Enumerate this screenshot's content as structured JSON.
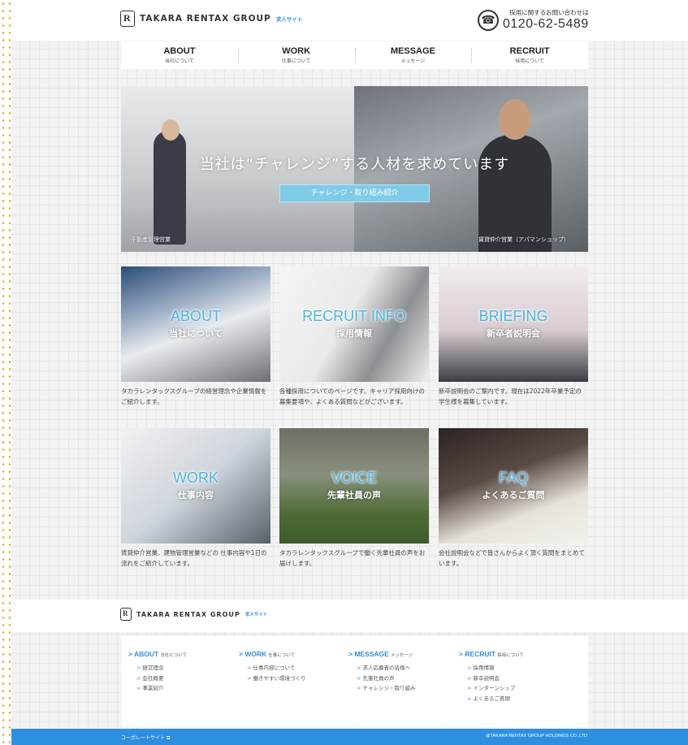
{
  "header": {
    "logo_text": "TAKARA RENTAX GROUP",
    "logo_sub": "求人サイト",
    "tel_caption": "採用に関するお問い合わせは",
    "tel_number": "0120-62-5489"
  },
  "nav": [
    {
      "en": "ABOUT",
      "ja": "当社について"
    },
    {
      "en": "WORK",
      "ja": "仕事について"
    },
    {
      "en": "MESSAGE",
      "ja": "メッセージ"
    },
    {
      "en": "RECRUIT",
      "ja": "採用について"
    }
  ],
  "hero": {
    "headline": "当社は“チャレンジ”する人材を求めています",
    "button": "チャレンジ・取り組み紹介",
    "caption_left": "不動産管理営業",
    "caption_right": "賃貸仲介営業（アパマンショップ）"
  },
  "cards": [
    {
      "en": "ABOUT",
      "ja": "当社について",
      "desc": "タカラレンタックスグループの経営理念や企業情報をご紹介します。"
    },
    {
      "en": "RECRUIT INFO",
      "ja": "採用情報",
      "desc": "各種採用についてのページです。キャリア採用向けの募集要項や、よくある質問などがございます。"
    },
    {
      "en": "BRIEFING",
      "ja": "新卒者説明会",
      "desc": "新卒説明会のご案内です。現在は2022年卒業予定の学生様を募集しています。"
    },
    {
      "en": "WORK",
      "ja": "仕事内容",
      "desc": "賃貸仲介営業、建物管理営業などの 仕事内容や1日の流れをご紹介しています。"
    },
    {
      "en": "VOICE",
      "ja": "先輩社員の声",
      "desc": "タカラレンタックスグループで働く先輩社員の声をお届けします。"
    },
    {
      "en": "FAQ",
      "ja": "よくあるご質問",
      "desc": "会社説明会などで皆さんからよく頂く質問をまとめています。"
    }
  ],
  "footer": {
    "logo_text": "TAKARA RENTAX GROUP",
    "logo_sub": "求人サイト",
    "columns": [
      {
        "head": "ABOUT",
        "head_ja": "当社について",
        "items": [
          "経営理念",
          "会社概要",
          "事業紹介"
        ]
      },
      {
        "head": "WORK",
        "head_ja": "仕事について",
        "items": [
          "仕事内容について",
          "働きやすい環境づくり"
        ]
      },
      {
        "head": "MESSAGE",
        "head_ja": "メッセージ",
        "items": [
          "求人応募者の皆様へ",
          "先輩社員の声",
          "チャレンジ・取り組み"
        ]
      },
      {
        "head": "RECRUIT",
        "head_ja": "採用について",
        "items": [
          "採用情報",
          "新卒説明会",
          "インターンシップ",
          "よくあるご質問"
        ]
      }
    ],
    "corporate_link": "コーポレートサイト",
    "copyright": "@TAKARA RENTAX GROUP HOLDINGS CO.,LTD"
  },
  "colors": {
    "accent": "#2d8fe0",
    "hero_button": "#7fcbe8",
    "card_title": "#4db4e0"
  }
}
